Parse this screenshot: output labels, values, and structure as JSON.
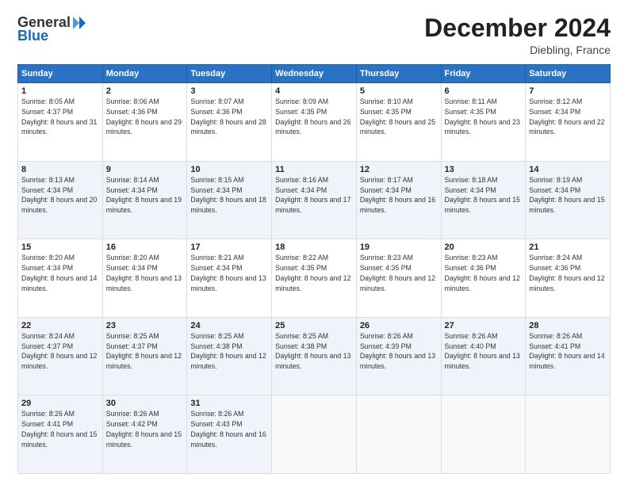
{
  "logo": {
    "general": "General",
    "blue": "Blue"
  },
  "title": "December 2024",
  "location": "Diebling, France",
  "days_header": [
    "Sunday",
    "Monday",
    "Tuesday",
    "Wednesday",
    "Thursday",
    "Friday",
    "Saturday"
  ],
  "weeks": [
    [
      {
        "num": "1",
        "sunrise": "Sunrise: 8:05 AM",
        "sunset": "Sunset: 4:37 PM",
        "daylight": "Daylight: 8 hours and 31 minutes."
      },
      {
        "num": "2",
        "sunrise": "Sunrise: 8:06 AM",
        "sunset": "Sunset: 4:36 PM",
        "daylight": "Daylight: 8 hours and 29 minutes."
      },
      {
        "num": "3",
        "sunrise": "Sunrise: 8:07 AM",
        "sunset": "Sunset: 4:36 PM",
        "daylight": "Daylight: 8 hours and 28 minutes."
      },
      {
        "num": "4",
        "sunrise": "Sunrise: 8:09 AM",
        "sunset": "Sunset: 4:35 PM",
        "daylight": "Daylight: 8 hours and 26 minutes."
      },
      {
        "num": "5",
        "sunrise": "Sunrise: 8:10 AM",
        "sunset": "Sunset: 4:35 PM",
        "daylight": "Daylight: 8 hours and 25 minutes."
      },
      {
        "num": "6",
        "sunrise": "Sunrise: 8:11 AM",
        "sunset": "Sunset: 4:35 PM",
        "daylight": "Daylight: 8 hours and 23 minutes."
      },
      {
        "num": "7",
        "sunrise": "Sunrise: 8:12 AM",
        "sunset": "Sunset: 4:34 PM",
        "daylight": "Daylight: 8 hours and 22 minutes."
      }
    ],
    [
      {
        "num": "8",
        "sunrise": "Sunrise: 8:13 AM",
        "sunset": "Sunset: 4:34 PM",
        "daylight": "Daylight: 8 hours and 20 minutes."
      },
      {
        "num": "9",
        "sunrise": "Sunrise: 8:14 AM",
        "sunset": "Sunset: 4:34 PM",
        "daylight": "Daylight: 8 hours and 19 minutes."
      },
      {
        "num": "10",
        "sunrise": "Sunrise: 8:15 AM",
        "sunset": "Sunset: 4:34 PM",
        "daylight": "Daylight: 8 hours and 18 minutes."
      },
      {
        "num": "11",
        "sunrise": "Sunrise: 8:16 AM",
        "sunset": "Sunset: 4:34 PM",
        "daylight": "Daylight: 8 hours and 17 minutes."
      },
      {
        "num": "12",
        "sunrise": "Sunrise: 8:17 AM",
        "sunset": "Sunset: 4:34 PM",
        "daylight": "Daylight: 8 hours and 16 minutes."
      },
      {
        "num": "13",
        "sunrise": "Sunrise: 8:18 AM",
        "sunset": "Sunset: 4:34 PM",
        "daylight": "Daylight: 8 hours and 15 minutes."
      },
      {
        "num": "14",
        "sunrise": "Sunrise: 8:19 AM",
        "sunset": "Sunset: 4:34 PM",
        "daylight": "Daylight: 8 hours and 15 minutes."
      }
    ],
    [
      {
        "num": "15",
        "sunrise": "Sunrise: 8:20 AM",
        "sunset": "Sunset: 4:34 PM",
        "daylight": "Daylight: 8 hours and 14 minutes."
      },
      {
        "num": "16",
        "sunrise": "Sunrise: 8:20 AM",
        "sunset": "Sunset: 4:34 PM",
        "daylight": "Daylight: 8 hours and 13 minutes."
      },
      {
        "num": "17",
        "sunrise": "Sunrise: 8:21 AM",
        "sunset": "Sunset: 4:34 PM",
        "daylight": "Daylight: 8 hours and 13 minutes."
      },
      {
        "num": "18",
        "sunrise": "Sunrise: 8:22 AM",
        "sunset": "Sunset: 4:35 PM",
        "daylight": "Daylight: 8 hours and 12 minutes."
      },
      {
        "num": "19",
        "sunrise": "Sunrise: 8:23 AM",
        "sunset": "Sunset: 4:35 PM",
        "daylight": "Daylight: 8 hours and 12 minutes."
      },
      {
        "num": "20",
        "sunrise": "Sunrise: 8:23 AM",
        "sunset": "Sunset: 4:36 PM",
        "daylight": "Daylight: 8 hours and 12 minutes."
      },
      {
        "num": "21",
        "sunrise": "Sunrise: 8:24 AM",
        "sunset": "Sunset: 4:36 PM",
        "daylight": "Daylight: 8 hours and 12 minutes."
      }
    ],
    [
      {
        "num": "22",
        "sunrise": "Sunrise: 8:24 AM",
        "sunset": "Sunset: 4:37 PM",
        "daylight": "Daylight: 8 hours and 12 minutes."
      },
      {
        "num": "23",
        "sunrise": "Sunrise: 8:25 AM",
        "sunset": "Sunset: 4:37 PM",
        "daylight": "Daylight: 8 hours and 12 minutes."
      },
      {
        "num": "24",
        "sunrise": "Sunrise: 8:25 AM",
        "sunset": "Sunset: 4:38 PM",
        "daylight": "Daylight: 8 hours and 12 minutes."
      },
      {
        "num": "25",
        "sunrise": "Sunrise: 8:25 AM",
        "sunset": "Sunset: 4:38 PM",
        "daylight": "Daylight: 8 hours and 13 minutes."
      },
      {
        "num": "26",
        "sunrise": "Sunrise: 8:26 AM",
        "sunset": "Sunset: 4:39 PM",
        "daylight": "Daylight: 8 hours and 13 minutes."
      },
      {
        "num": "27",
        "sunrise": "Sunrise: 8:26 AM",
        "sunset": "Sunset: 4:40 PM",
        "daylight": "Daylight: 8 hours and 13 minutes."
      },
      {
        "num": "28",
        "sunrise": "Sunrise: 8:26 AM",
        "sunset": "Sunset: 4:41 PM",
        "daylight": "Daylight: 8 hours and 14 minutes."
      }
    ],
    [
      {
        "num": "29",
        "sunrise": "Sunrise: 8:26 AM",
        "sunset": "Sunset: 4:41 PM",
        "daylight": "Daylight: 8 hours and 15 minutes."
      },
      {
        "num": "30",
        "sunrise": "Sunrise: 8:26 AM",
        "sunset": "Sunset: 4:42 PM",
        "daylight": "Daylight: 8 hours and 15 minutes."
      },
      {
        "num": "31",
        "sunrise": "Sunrise: 8:26 AM",
        "sunset": "Sunset: 4:43 PM",
        "daylight": "Daylight: 8 hours and 16 minutes."
      },
      null,
      null,
      null,
      null
    ]
  ]
}
